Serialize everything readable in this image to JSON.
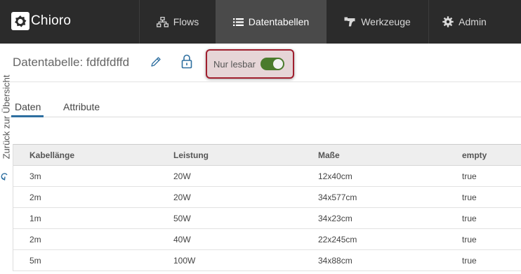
{
  "nav": {
    "brand": "Chioro",
    "items": [
      {
        "label": "Flows",
        "icon": "sitemap-icon"
      },
      {
        "label": "Datentabellen",
        "icon": "list-icon",
        "active": true
      },
      {
        "label": "Werkzeuge",
        "icon": "tools-icon"
      },
      {
        "label": "Admin",
        "icon": "gear-icon"
      }
    ]
  },
  "sidebar": {
    "back_label": "Zurück zur Übersicht"
  },
  "header": {
    "title": "Datentabelle: fdfdfdffd",
    "readonly_label": "Nur lesbar",
    "readonly_on": true
  },
  "tabs": [
    {
      "label": "Daten",
      "active": true
    },
    {
      "label": "Attribute",
      "active": false
    }
  ],
  "table": {
    "columns": [
      "Kabellänge",
      "Leistung",
      "Maße",
      "empty"
    ],
    "rows": [
      [
        "3m",
        "20W",
        "12x40cm",
        "true"
      ],
      [
        "2m",
        "20W",
        "34x577cm",
        "true"
      ],
      [
        "1m",
        "50W",
        "34x23cm",
        "true"
      ],
      [
        "2m",
        "40W",
        "22x245cm",
        "true"
      ],
      [
        "5m",
        "100W",
        "34x88cm",
        "true"
      ]
    ]
  },
  "colors": {
    "topbar": "#2b2b2b",
    "active_tab": "#4a4a4a",
    "toggle_on": "#4a7b2c",
    "highlight_border": "#a01e2e",
    "tab_accent": "#2e6fa0"
  }
}
